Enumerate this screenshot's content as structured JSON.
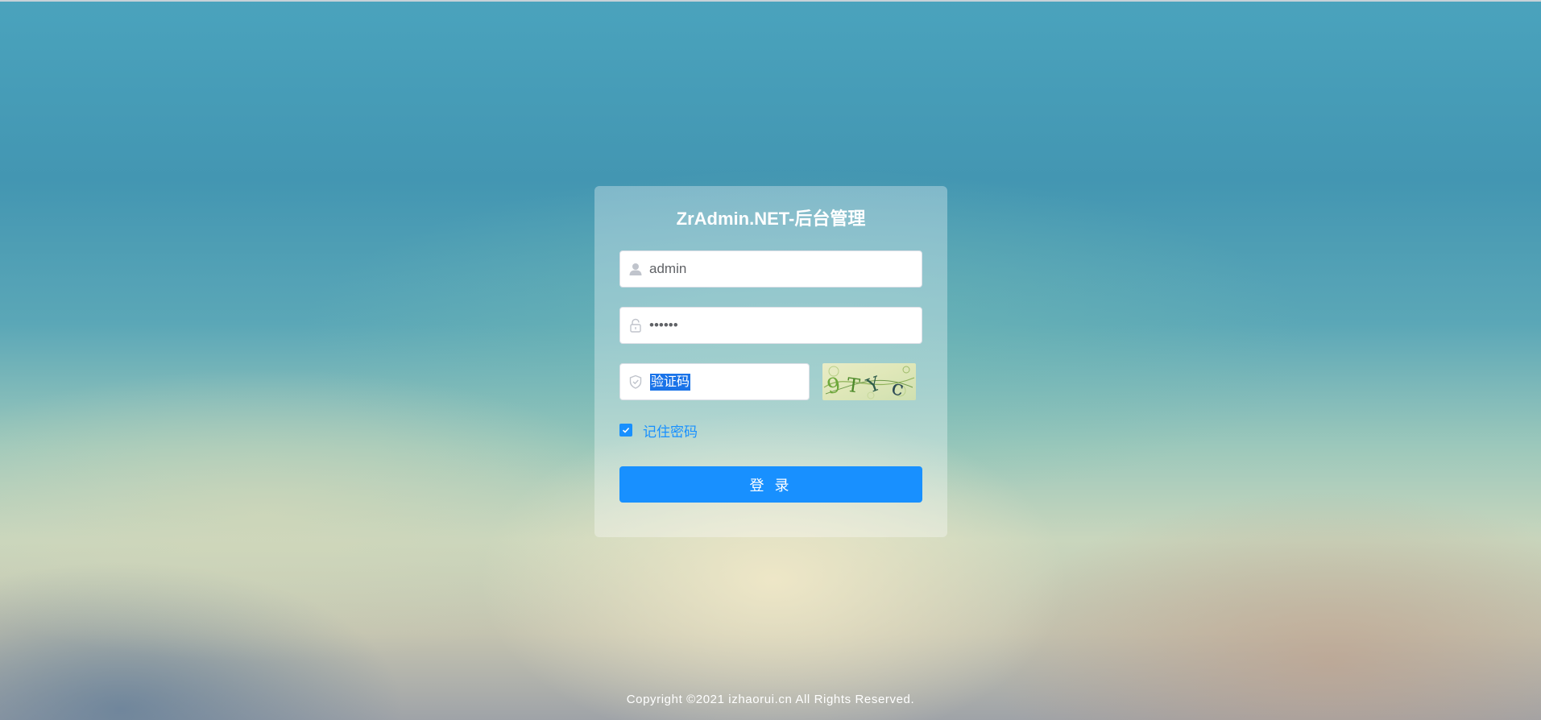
{
  "login": {
    "title": "ZrAdmin.NET-后台管理",
    "username_value": "admin",
    "password_value": "••••••",
    "captcha_selected_text": "验证码",
    "captcha_placeholder": "验证码",
    "remember_label": "记住密码",
    "remember_checked": true,
    "submit_label": "登 录"
  },
  "icons": {
    "username": "user-icon",
    "password": "lock-icon",
    "captcha": "shield-check-icon",
    "remember": "check-icon"
  },
  "colors": {
    "primary": "#1890ff",
    "selection": "#1a73e8"
  },
  "footer": {
    "copyright": "Copyright ©2021 izhaorui.cn All Rights Reserved."
  }
}
